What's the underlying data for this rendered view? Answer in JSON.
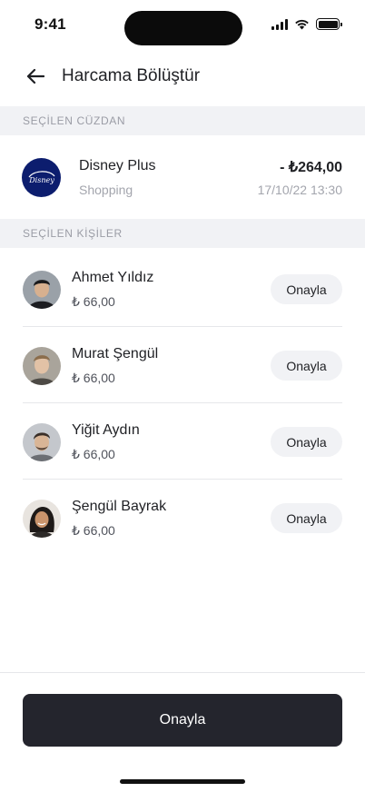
{
  "status_bar": {
    "time": "9:41"
  },
  "header": {
    "title": "Harcama Bölüştür",
    "back_icon": "arrow-left-icon"
  },
  "wallet_section": {
    "heading": "SEÇİLEN CÜZDAN",
    "item": {
      "name": "Disney Plus",
      "category": "Shopping",
      "amount": "- ₺264,00",
      "date": "17/10/22 13:30",
      "logo_color": "#0c1d6e"
    }
  },
  "people_section": {
    "heading": "SEÇİLEN KİŞİLER",
    "people": [
      {
        "name": "Ahmet Yıldız",
        "amount": "₺ 66,00",
        "action": "Onayla"
      },
      {
        "name": "Murat Şengül",
        "amount": "₺ 66,00",
        "action": "Onayla"
      },
      {
        "name": "Yiğit Aydın",
        "amount": "₺ 66,00",
        "action": "Onayla"
      },
      {
        "name": "Şengül Bayrak",
        "amount": "₺ 66,00",
        "action": "Onayla"
      }
    ]
  },
  "footer": {
    "primary_label": "Onayla"
  },
  "colors": {
    "primary": "#24252d",
    "section_bg": "#f1f2f5",
    "muted_text": "#a3a5ad"
  }
}
